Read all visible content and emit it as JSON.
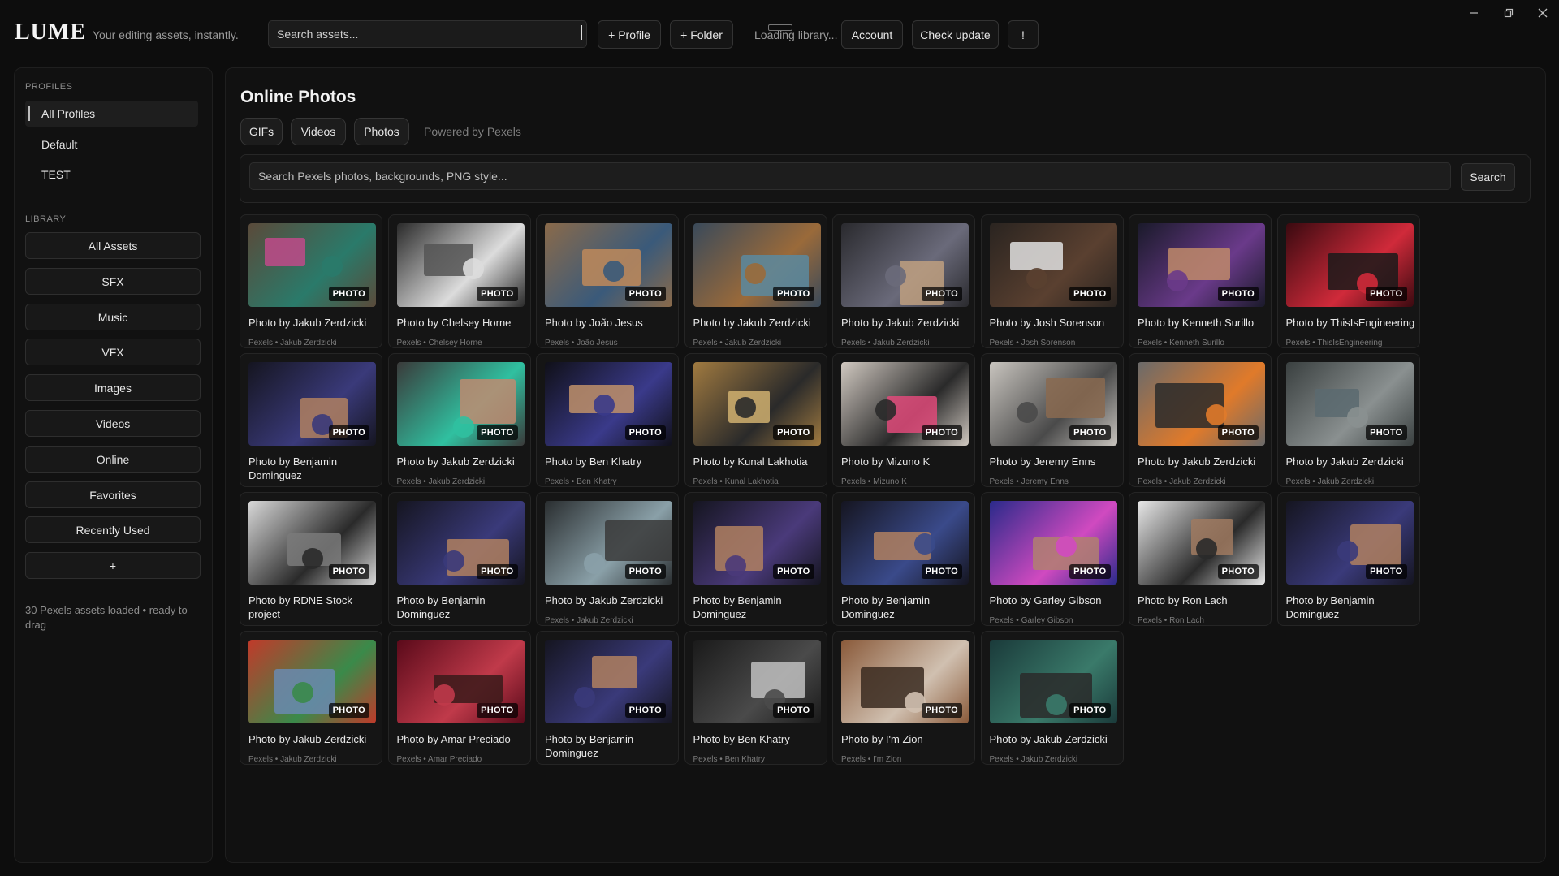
{
  "app": {
    "logo": "LUME",
    "tagline": "Your editing assets, instantly.",
    "search_placeholder": "Search assets...",
    "profile_button": "+ Profile",
    "folder_button": "+ Folder",
    "loading_text": "Loading library...",
    "account_button": "Account",
    "check_update_button": "Check update",
    "alert_button": "!",
    "window_controls": [
      "minimize",
      "restore",
      "close"
    ]
  },
  "sidebar": {
    "profiles_label": "PROFILES",
    "profiles": [
      "All Profiles",
      "Default",
      "TEST"
    ],
    "library_label": "LIBRARY",
    "library": [
      "All Assets",
      "SFX",
      "Music",
      "VFX",
      "Images",
      "Videos",
      "Online",
      "Favorites",
      "Recently Used",
      "+"
    ],
    "status": "30 Pexels assets loaded • ready to drag"
  },
  "main": {
    "title": "Online Photos",
    "tabs": [
      "GIFs",
      "Videos",
      "Photos"
    ],
    "powered_by": "Powered by Pexels",
    "search_placeholder": "Search Pexels photos, backgrounds, PNG style...",
    "search_button": "Search",
    "badge_label": "PHOTO",
    "cards": [
      {
        "title": "Photo by Jakub Zerdzicki",
        "sub": "Pexels • Jakub Zerdzicki",
        "colors": [
          "#5a4a3a",
          "#2a7a6a",
          "#c04a8a"
        ]
      },
      {
        "title": "Photo by Chelsey Horne",
        "sub": "Pexels • Chelsey Horne",
        "colors": [
          "#2a2a2a",
          "#dcdcdc",
          "#555555"
        ]
      },
      {
        "title": "Photo by João  Jesus",
        "sub": "Pexels • João  Jesus",
        "colors": [
          "#8a6a4a",
          "#3a5a7a",
          "#c08a5a"
        ]
      },
      {
        "title": "Photo by Jakub Zerdzicki",
        "sub": "Pexels • Jakub Zerdzicki",
        "colors": [
          "#3a4a5a",
          "#9a6a3a",
          "#5a8aa0"
        ]
      },
      {
        "title": "Photo by Jakub Zerdzicki",
        "sub": "Pexels • Jakub Zerdzicki",
        "colors": [
          "#2a2a2e",
          "#6a6a7a",
          "#c0a080"
        ]
      },
      {
        "title": "Photo by Josh Sorenson",
        "sub": "Pexels • Josh Sorenson",
        "colors": [
          "#2a2420",
          "#5a4030",
          "#e0e0e0"
        ]
      },
      {
        "title": "Photo by Kenneth Surillo",
        "sub": "Pexels • Kenneth Surillo",
        "colors": [
          "#1a1a2a",
          "#6a3a8a",
          "#c08a6a"
        ]
      },
      {
        "title": "Photo by ThisIsEngineering",
        "sub": "Pexels • ThisIsEngineering",
        "colors": [
          "#3a0a10",
          "#d02a3a",
          "#1a1a1a"
        ]
      },
      {
        "title": "Photo by Benjamin Dominguez",
        "sub": "",
        "colors": [
          "#151520",
          "#3a3a7a",
          "#b08060"
        ]
      },
      {
        "title": "Photo by Jakub Zerdzicki",
        "sub": "Pexels • Jakub Zerdzicki",
        "colors": [
          "#3a3a3a",
          "#30c0a0",
          "#c08a70"
        ]
      },
      {
        "title": "Photo by Ben Khatry",
        "sub": "Pexels • Ben Khatry",
        "colors": [
          "#101018",
          "#3a3a8a",
          "#c0906a"
        ]
      },
      {
        "title": "Photo by Kunal Lakhotia",
        "sub": "Pexels • Kunal Lakhotia",
        "colors": [
          "#a07a40",
          "#2a2a2a",
          "#d0b070"
        ]
      },
      {
        "title": "Photo by Mizuno K",
        "sub": "Pexels • Mizuno K",
        "colors": [
          "#d0c8c0",
          "#2a2a2a",
          "#e04a7a"
        ]
      },
      {
        "title": "Photo by Jeremy Enns",
        "sub": "Pexels • Jeremy Enns",
        "colors": [
          "#c8c4be",
          "#4a4a4a",
          "#8a6a50"
        ]
      },
      {
        "title": "Photo by Jakub Zerdzicki",
        "sub": "Pexels • Jakub Zerdzicki",
        "colors": [
          "#6a6a6a",
          "#e07a2a",
          "#2a2a2a"
        ]
      },
      {
        "title": "Photo by Jakub Zerdzicki",
        "sub": "Pexels • Jakub Zerdzicki",
        "colors": [
          "#3a4040",
          "#8a9090",
          "#5a6a70"
        ]
      },
      {
        "title": "Photo by RDNE Stock project",
        "sub": "",
        "colors": [
          "#d8d8d8",
          "#2a2a2a",
          "#7a7a7a"
        ]
      },
      {
        "title": "Photo by Benjamin Dominguez",
        "sub": "",
        "colors": [
          "#151520",
          "#3a3a7a",
          "#b08060"
        ]
      },
      {
        "title": "Photo by Jakub Zerdzicki",
        "sub": "Pexels • Jakub Zerdzicki",
        "colors": [
          "#2a2e30",
          "#8aa0a8",
          "#3a3a3a"
        ]
      },
      {
        "title": "Photo by Benjamin Dominguez",
        "sub": "",
        "colors": [
          "#151520",
          "#4a3a7a",
          "#b08060"
        ]
      },
      {
        "title": "Photo by Benjamin Dominguez",
        "sub": "",
        "colors": [
          "#151520",
          "#3a4a8a",
          "#b08060"
        ]
      },
      {
        "title": "Photo by Garley Gibson",
        "sub": "Pexels • Garley Gibson",
        "colors": [
          "#2a2a8a",
          "#d04ac0",
          "#b08070"
        ]
      },
      {
        "title": "Photo by Ron Lach",
        "sub": "Pexels • Ron Lach",
        "colors": [
          "#e8e8e8",
          "#2a2a2a",
          "#a07a60"
        ]
      },
      {
        "title": "Photo by Benjamin Dominguez",
        "sub": "",
        "colors": [
          "#151520",
          "#3a3a7a",
          "#b08060"
        ]
      },
      {
        "title": "Photo by Jakub Zerdzicki",
        "sub": "Pexels • Jakub Zerdzicki",
        "colors": [
          "#c03a2a",
          "#3a8a4a",
          "#6a8ab0"
        ]
      },
      {
        "title": "Photo by Amar  Preciado",
        "sub": "Pexels • Amar  Preciado",
        "colors": [
          "#5a0a1a",
          "#c03a4a",
          "#3a1a1a"
        ]
      },
      {
        "title": "Photo by Benjamin Dominguez",
        "sub": "",
        "colors": [
          "#151520",
          "#3a3a7a",
          "#b08060"
        ]
      },
      {
        "title": "Photo by Ben Khatry",
        "sub": "Pexels • Ben Khatry",
        "colors": [
          "#1a1a1a",
          "#4a4a4a",
          "#c0c0c0"
        ]
      },
      {
        "title": "Photo by I'm Zion",
        "sub": "Pexels • I'm Zion",
        "colors": [
          "#8a5a3a",
          "#d0c0b0",
          "#3a2a20"
        ]
      },
      {
        "title": "Photo by Jakub Zerdzicki",
        "sub": "Pexels • Jakub Zerdzicki",
        "colors": [
          "#1a3a3a",
          "#3a7a6a",
          "#2a2a2a"
        ]
      }
    ]
  }
}
